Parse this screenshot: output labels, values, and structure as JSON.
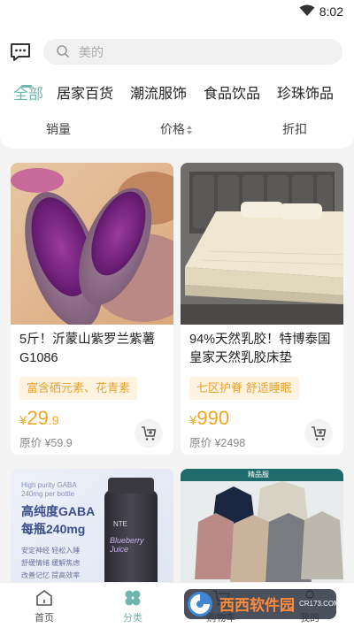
{
  "status": {
    "time": "8:02",
    "wifi_icon": "wifi-icon"
  },
  "header": {
    "message_icon": "chat-icon",
    "search_placeholder": "美的"
  },
  "tabs": [
    {
      "label": "全部",
      "active": true
    },
    {
      "label": "居家百货"
    },
    {
      "label": "潮流服饰"
    },
    {
      "label": "食品饮品"
    },
    {
      "label": "珍珠饰品"
    }
  ],
  "sort": {
    "sales": "销量",
    "price": "价格",
    "discount": "折扣"
  },
  "products": [
    {
      "title": "5斤！沂蒙山紫罗兰紫薯G1086",
      "tag": "富含硒元素、花青素",
      "currency": "¥",
      "price_int": "29",
      "price_dec": ".9",
      "original": "原价 ¥59.9"
    },
    {
      "title": "94%天然乳胶！特博泰国皇家天然乳胶床垫",
      "tag": "七区护脊  舒适睡眠",
      "currency": "¥",
      "price_int": "990",
      "price_dec": "",
      "original": "原价 ¥2498"
    },
    {
      "img_text_1": "高纯度GABA",
      "img_text_2": "每瓶240mg",
      "img_small_1": "High purity GABA",
      "img_small_2": "240mg per bottle",
      "features": [
        "安定神经 轻松入睡",
        "舒缓情绪 缓解焦虑",
        "改善记忆 提高效率"
      ],
      "bottle_brand": "NTE",
      "bottle_label": "Blueberry Juice"
    },
    {
      "banner_text": "精品服"
    }
  ],
  "nav": [
    {
      "label": "首页",
      "icon": "home-icon"
    },
    {
      "label": "分类",
      "icon": "category-icon",
      "active": true
    },
    {
      "label": "购物车",
      "icon": "cart-icon"
    },
    {
      "label": "我的",
      "icon": "user-icon"
    }
  ],
  "watermark": {
    "text": "西西软件园",
    "url": "CR173.COM"
  },
  "colors": {
    "accent": "#6fb7ac",
    "price": "#f0a722",
    "tag_bg": "#fdf3e0"
  }
}
